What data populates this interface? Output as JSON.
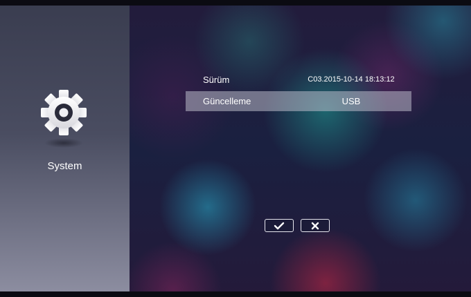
{
  "sidebar": {
    "icon": "gear-icon",
    "label": "System"
  },
  "settings": {
    "rows": [
      {
        "label": "Sürüm",
        "value": "C03.2015-10-14 18:13:12"
      },
      {
        "label": "Güncelleme",
        "value": "USB"
      }
    ],
    "selected_index": 1
  },
  "buttons": {
    "confirm_icon": "check-icon",
    "cancel_icon": "x-icon"
  },
  "colors": {
    "selected_row": "#b9b9c8",
    "text": "#ffffff"
  }
}
